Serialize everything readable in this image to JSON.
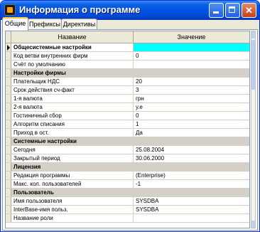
{
  "window": {
    "title": "Информация о программе"
  },
  "tabs": [
    {
      "label": "Общие"
    },
    {
      "label": "Префиксы"
    },
    {
      "label": "Директивы"
    }
  ],
  "grid": {
    "columns": {
      "name": "Название",
      "value": "Значение"
    },
    "rows": [
      {
        "name": "Общесистемные настройки",
        "value": "",
        "type": "group"
      },
      {
        "name": "Код ветви внутренних фирм",
        "value": "0",
        "type": "item"
      },
      {
        "name": "Счёт по умолчанию",
        "value": "",
        "type": "item"
      },
      {
        "name": "Настройки фирмы",
        "value": "",
        "type": "group"
      },
      {
        "name": "Плательщик НДС",
        "value": "20",
        "type": "item"
      },
      {
        "name": "Срок действия сч-факт",
        "value": "3",
        "type": "item"
      },
      {
        "name": "1-я валюта",
        "value": "грн",
        "type": "item"
      },
      {
        "name": "2-я валюта",
        "value": "у.е",
        "type": "item"
      },
      {
        "name": "Гостиничный сбор",
        "value": "0",
        "type": "item"
      },
      {
        "name": "Алгоритм списания",
        "value": "1",
        "type": "item"
      },
      {
        "name": "Приход в ост.",
        "value": "Да",
        "type": "item"
      },
      {
        "name": "Системные настройки",
        "value": "",
        "type": "group"
      },
      {
        "name": "Сегодня",
        "value": "25.08.2004",
        "type": "item"
      },
      {
        "name": "Закрытый период",
        "value": "30.06.2000",
        "type": "item"
      },
      {
        "name": "Лицензия",
        "value": "",
        "type": "group"
      },
      {
        "name": "Редакция программы",
        "value": "(Enterprise)",
        "type": "item"
      },
      {
        "name": "Макс. кол. пользователей",
        "value": "-1",
        "type": "item"
      },
      {
        "name": "Пользователь",
        "value": "",
        "type": "group"
      },
      {
        "name": "Имя пользователя",
        "value": "SYSDBA",
        "type": "item"
      },
      {
        "name": "InterBase-имя польз.",
        "value": "SYSDBA",
        "type": "item"
      },
      {
        "name": "Название роли",
        "value": "",
        "type": "item"
      }
    ]
  },
  "colors": {
    "selected_value": "#00ffff",
    "group_row": "#d4d0c8",
    "title_bar": "#0055e5"
  }
}
